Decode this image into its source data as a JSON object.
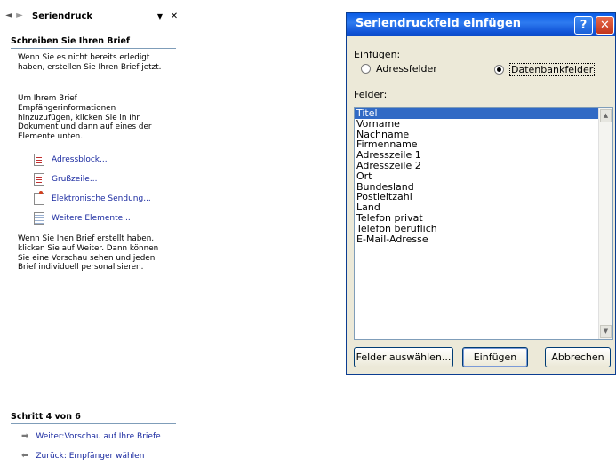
{
  "pane": {
    "title": "Seriendruck",
    "section1": {
      "title": "Schreiben Sie Ihren Brief",
      "para1": "Wenn Sie es nicht bereits erledigt haben, erstellen Sie Ihren Brief jetzt.",
      "para2": "Um Ihrem Brief Empfängerinformationen hinzuzufügen, klicken Sie in Ihr Dokument und dann auf eines der Elemente unten.",
      "links": [
        {
          "label": "Adressblock...",
          "icon": "address-block-icon"
        },
        {
          "label": "Grußzeile...",
          "icon": "greeting-line-icon"
        },
        {
          "label": "Elektronische Sendung...",
          "icon": "electronic-postage-icon"
        },
        {
          "label": "Weitere Elemente...",
          "icon": "more-items-icon"
        }
      ],
      "para3": "Wenn Sie Ihen Brief erstellt haben, klicken Sie auf Weiter. Dann können Sie eine Vorschau sehen und jeden Brief individuell personalisieren."
    },
    "step": {
      "title": "Schritt 4 von 6",
      "next": "Weiter:Vorschau auf Ihre Briefe",
      "prev": "Zurück: Empfänger wählen"
    }
  },
  "dialog": {
    "title": "Seriendruckfeld einfügen",
    "help_glyph": "?",
    "close_glyph": "✕",
    "insert_label": "Einfügen:",
    "radio_address": "Adressfelder",
    "radio_db": "Datenbankfelder",
    "fields_label": "Felder:",
    "fields": [
      "Titel",
      "Vorname",
      "Nachname",
      "Firmenname",
      "Adresszeile 1",
      "Adresszeile 2",
      "Ort",
      "Bundesland",
      "Postleitzahl",
      "Land",
      "Telefon privat",
      "Telefon beruflich",
      "E-Mail-Adresse"
    ],
    "selected_field": "Titel",
    "buttons": {
      "select_fields": "Felder auswählen...",
      "insert": "Einfügen",
      "cancel": "Abbrechen"
    }
  }
}
